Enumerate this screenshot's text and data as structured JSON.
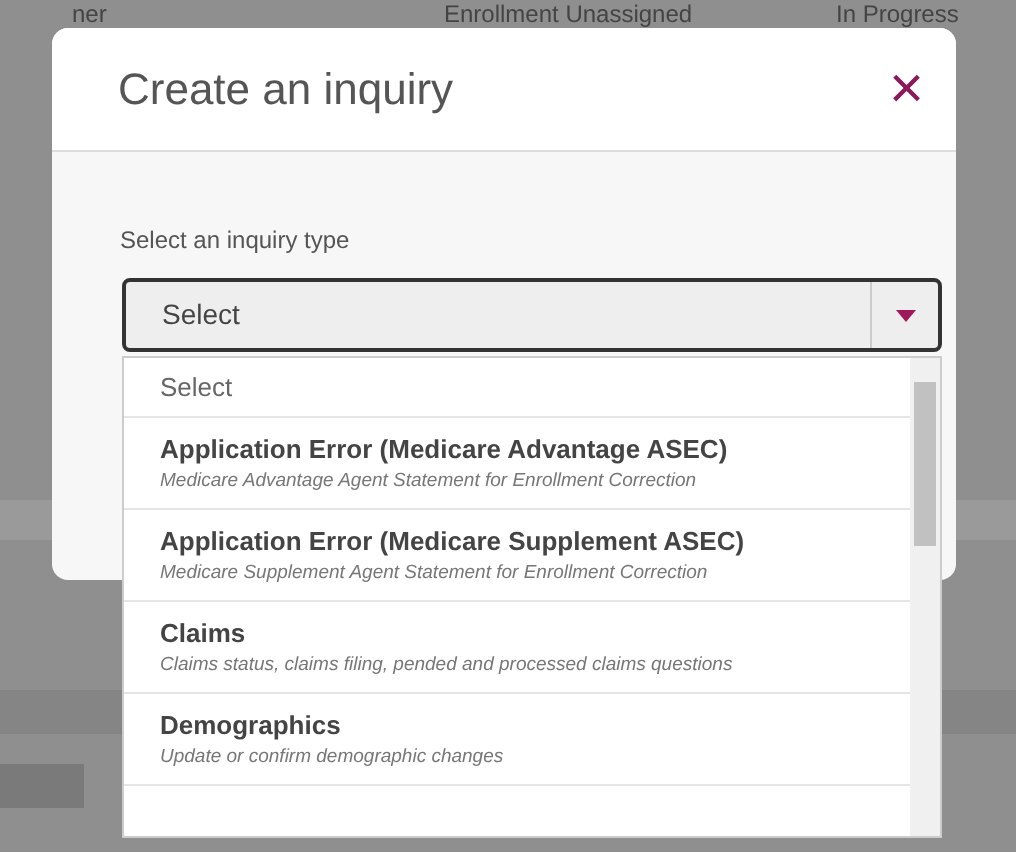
{
  "background_page": {
    "headers": [
      "ner",
      "Enrollment Unassigned",
      "In Progress"
    ]
  },
  "modal": {
    "title": "Create an inquiry",
    "close_icon": "×",
    "field_label": "Select an inquiry type",
    "select": {
      "value": "Select",
      "expanded": true
    }
  },
  "dropdown": {
    "options": [
      {
        "kind": "placeholder",
        "title": "Select"
      },
      {
        "kind": "option",
        "title": "Application Error (Medicare Advantage ASEC)",
        "description": "Medicare Advantage Agent Statement for Enrollment Correction"
      },
      {
        "kind": "option",
        "title": "Application Error (Medicare Supplement ASEC)",
        "description": "Medicare Supplement Agent Statement for Enrollment Correction"
      },
      {
        "kind": "option",
        "title": "Claims",
        "description": "Claims status, claims filing, pended and processed claims questions"
      },
      {
        "kind": "option",
        "title": "Demographics",
        "description": "Update or confirm demographic changes"
      }
    ]
  }
}
